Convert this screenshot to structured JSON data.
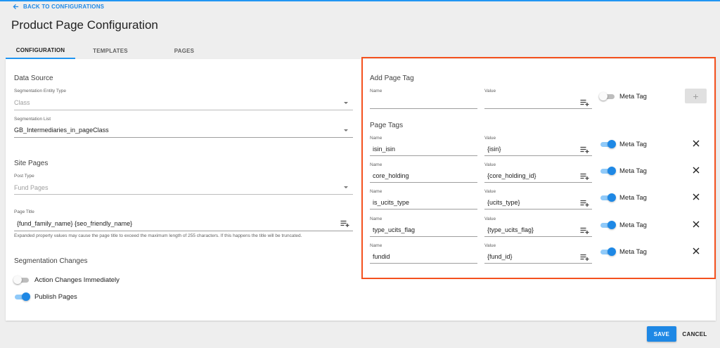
{
  "nav": {
    "back_label": "BACK TO CONFIGURATIONS"
  },
  "page": {
    "title": "Product Page Configuration"
  },
  "tabs": [
    {
      "label": "CONFIGURATION",
      "active": true
    },
    {
      "label": "TEMPLATES",
      "active": false
    },
    {
      "label": "PAGES",
      "active": false
    }
  ],
  "data_source": {
    "title": "Data Source",
    "entity_type": {
      "label": "Segmentation Entity Type",
      "value": "Class"
    },
    "segmentation_list": {
      "label": "Segmentation List",
      "value": "GB_Intermediaries_in_pageClass"
    }
  },
  "site_pages": {
    "title": "Site Pages",
    "post_type": {
      "label": "Post Type",
      "value": "Fund Pages"
    },
    "page_title": {
      "label": "Page Title",
      "value": "{fund_family_name} {seo_friendly_name}",
      "helper": "Expanded property values may cause the page title to exceed the maximum length of 255 characters. If this happens the title will be truncated."
    }
  },
  "segmentation_changes": {
    "title": "Segmentation Changes",
    "action_changes": {
      "label": "Action Changes Immediately",
      "on": false
    },
    "publish_pages": {
      "label": "Publish Pages",
      "on": true
    }
  },
  "add_page_tag": {
    "title": "Add Page Tag",
    "name_label": "Name",
    "name_value": "",
    "value_label": "Value",
    "value_value": "",
    "meta_tag_label": "Meta Tag",
    "meta_tag_on": false,
    "add_button": "+"
  },
  "page_tags": {
    "title": "Page Tags",
    "items": [
      {
        "name_label": "Name",
        "name": "isin_isin",
        "value_label": "Value",
        "value": "{isin}",
        "meta_label": "Meta Tag",
        "meta_on": true
      },
      {
        "name_label": "Name",
        "name": "core_holding",
        "value_label": "Value",
        "value": "{core_holding_id}",
        "meta_label": "Meta Tag",
        "meta_on": true
      },
      {
        "name_label": "Name",
        "name": "is_ucits_type",
        "value_label": "Value",
        "value": "{ucits_type}",
        "meta_label": "Meta Tag",
        "meta_on": true
      },
      {
        "name_label": "Name",
        "name": "type_ucits_flag",
        "value_label": "Value",
        "value": "{type_ucits_flag}",
        "meta_label": "Meta Tag",
        "meta_on": true
      },
      {
        "name_label": "Name",
        "name": "fundid",
        "value_label": "Value",
        "value": "{fund_id}",
        "meta_label": "Meta Tag",
        "meta_on": true
      }
    ]
  },
  "footer": {
    "save_label": "SAVE",
    "cancel_label": "CANCEL"
  },
  "colors": {
    "accent": "#1e88e5",
    "highlight": "#f4511e",
    "background": "#eeeeee"
  },
  "icons": {
    "back": "arrow-left-icon",
    "insert_property": "playlist-add-icon",
    "remove": "close-icon",
    "dropdown": "caret-down-icon"
  }
}
